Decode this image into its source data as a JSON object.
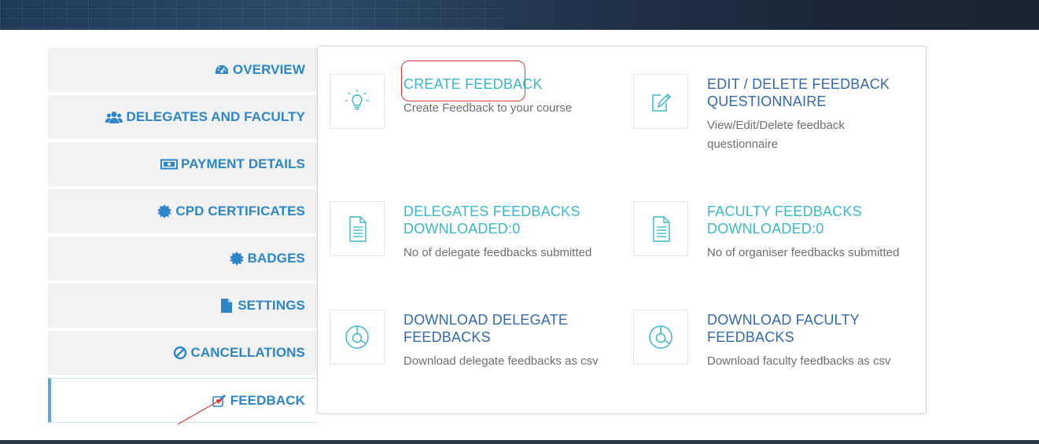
{
  "colors": {
    "sidebar_text": "#2c86c9",
    "sidebar_bg": "#f2f2f2",
    "active_border": "#58a9d9",
    "teal": "#3ab8c9",
    "blue": "#3469ad",
    "desc": "#6f6f6f",
    "annotation": "#e03a3a"
  },
  "sidebar": {
    "items": [
      {
        "label": "OVERVIEW",
        "icon": "dashboard-icon"
      },
      {
        "label": "DELEGATES AND FACULTY",
        "icon": "users-icon"
      },
      {
        "label": "PAYMENT DETAILS",
        "icon": "money-icon"
      },
      {
        "label": "CPD CERTIFICATES",
        "icon": "certificate-icon"
      },
      {
        "label": "BADGES",
        "icon": "certificate-icon"
      },
      {
        "label": "SETTINGS",
        "icon": "file-icon"
      },
      {
        "label": "CANCELLATIONS",
        "icon": "ban-icon"
      },
      {
        "label": "FEEDBACK",
        "icon": "edit-icon",
        "active": true
      }
    ]
  },
  "cards": [
    {
      "title": "CREATE FEEDBACK",
      "description": "Create Feedback to your course",
      "icon": "lightbulb-icon"
    },
    {
      "title": "EDIT / DELETE FEEDBACK QUESTIONNAIRE",
      "description": "View/Edit/Delete feedback questionnaire",
      "icon": "edit-document-icon"
    },
    {
      "title": "DELEGATES FEEDBACKS DOWNLOADED:0",
      "description": "No of delegate feedbacks submitted",
      "icon": "document-icon"
    },
    {
      "title": "FACULTY FEEDBACKS DOWNLOADED:0",
      "description": "No of organiser feedbacks submitted",
      "icon": "document-icon"
    },
    {
      "title": "DOWNLOAD DELEGATE FEEDBACKS",
      "description": "Download delegate feedbacks as csv",
      "icon": "pie-chart-icon"
    },
    {
      "title": "DOWNLOAD FACULTY FEEDBACKS",
      "description": "Download faculty feedbacks as csv",
      "icon": "pie-chart-icon"
    }
  ]
}
